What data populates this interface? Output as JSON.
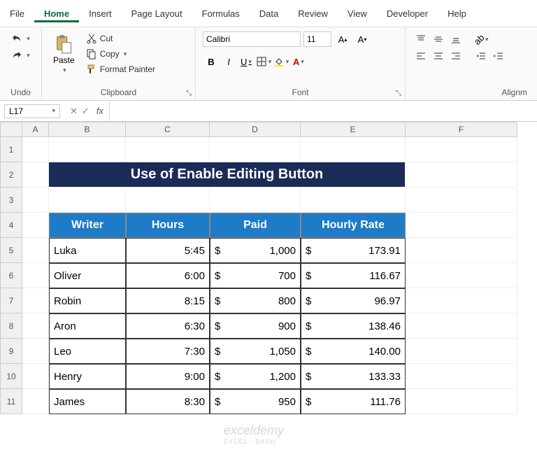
{
  "menu": [
    "File",
    "Home",
    "Insert",
    "Page Layout",
    "Formulas",
    "Data",
    "Review",
    "View",
    "Developer",
    "Help"
  ],
  "menu_active": "Home",
  "ribbon": {
    "undo": {
      "label": "Undo"
    },
    "clipboard": {
      "paste": "Paste",
      "cut": "Cut",
      "copy": "Copy",
      "fmt": "Format Painter",
      "label": "Clipboard"
    },
    "font": {
      "name": "Calibri",
      "size": "11",
      "label": "Font"
    },
    "align": {
      "label": "Alignm"
    }
  },
  "namebox": "L17",
  "fx": "fx",
  "col_headers": [
    "A",
    "B",
    "C",
    "D",
    "E",
    "F"
  ],
  "row_headers": [
    "1",
    "2",
    "3",
    "4",
    "5",
    "6",
    "7",
    "8",
    "9",
    "10",
    "11"
  ],
  "title": "Use of Enable Editing Button",
  "headers": [
    "Writer",
    "Hours",
    "Paid",
    "Hourly Rate"
  ],
  "rows": [
    {
      "w": "Luka",
      "h": "5:45",
      "p": "1,000",
      "r": "173.91"
    },
    {
      "w": "Oliver",
      "h": "6:00",
      "p": "700",
      "r": "116.67"
    },
    {
      "w": "Robin",
      "h": "8:15",
      "p": "800",
      "r": "96.97"
    },
    {
      "w": "Aron",
      "h": "6:30",
      "p": "900",
      "r": "138.46"
    },
    {
      "w": "Leo",
      "h": "7:30",
      "p": "1,050",
      "r": "140.00"
    },
    {
      "w": "Henry",
      "h": "9:00",
      "p": "1,200",
      "r": "133.33"
    },
    {
      "w": "James",
      "h": "8:30",
      "p": "950",
      "r": "111.76"
    }
  ],
  "currency": "$",
  "watermark": {
    "main": "exceldemy",
    "sub": "EXCEL · DASH"
  },
  "chart_data": {
    "type": "table",
    "title": "Use of Enable Editing Button",
    "columns": [
      "Writer",
      "Hours",
      "Paid ($)",
      "Hourly Rate ($)"
    ],
    "rows": [
      [
        "Luka",
        "5:45",
        1000,
        173.91
      ],
      [
        "Oliver",
        "6:00",
        700,
        116.67
      ],
      [
        "Robin",
        "8:15",
        800,
        96.97
      ],
      [
        "Aron",
        "6:30",
        900,
        138.46
      ],
      [
        "Leo",
        "7:30",
        1050,
        140.0
      ],
      [
        "Henry",
        "9:00",
        1200,
        133.33
      ],
      [
        "James",
        "8:30",
        950,
        111.76
      ]
    ]
  }
}
